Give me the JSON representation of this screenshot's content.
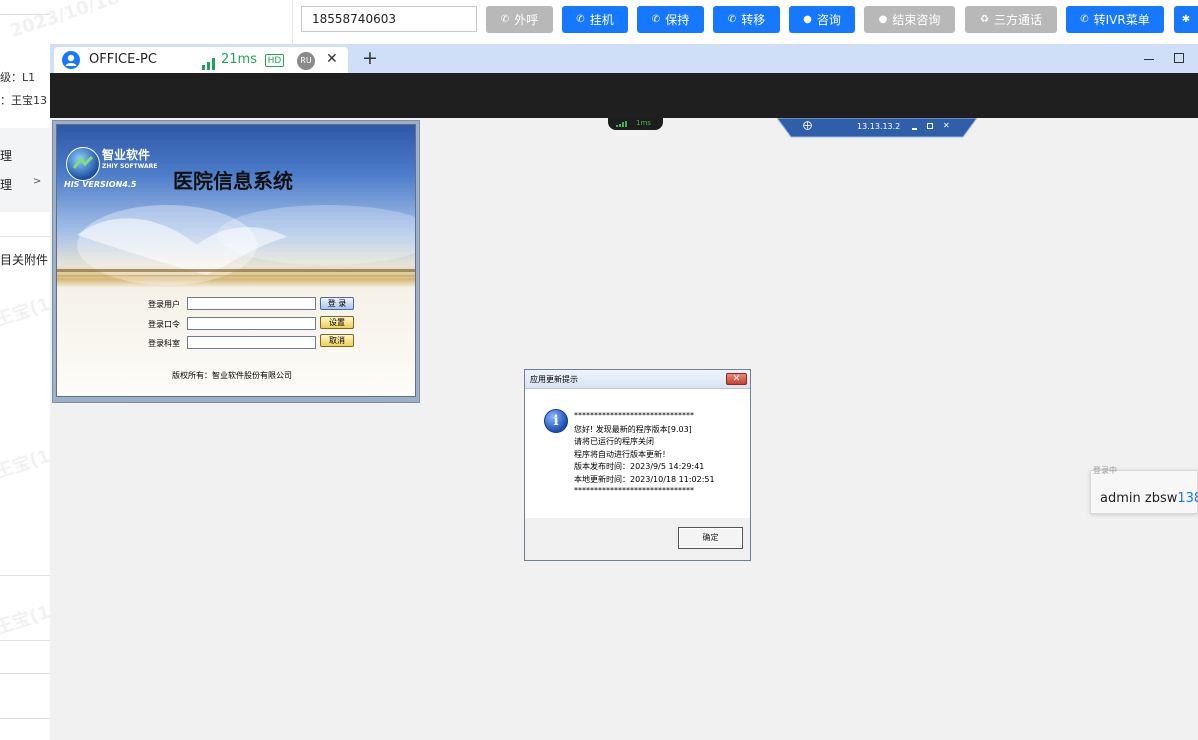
{
  "left_panel": {
    "level_label": "级：L1",
    "user_label": "：王宝13",
    "nav_item_1": "理",
    "nav_item_2": "理",
    "nav_item_2_arrow": ">",
    "attachments_label": "目关附件",
    "watermark_name": "王宝(1",
    "watermark_date": "2023/10/18"
  },
  "call_toolbar": {
    "phone_number": "18558740603",
    "buttons": [
      {
        "label": "外呼",
        "icon": "phone-icon",
        "style": "gray"
      },
      {
        "label": "挂机",
        "icon": "phone-icon",
        "style": "blue"
      },
      {
        "label": "保持",
        "icon": "phone-icon",
        "style": "blue"
      },
      {
        "label": "转移",
        "icon": "phone-icon",
        "style": "blue"
      },
      {
        "label": "咨询",
        "icon": "chat-icon",
        "style": "blue"
      },
      {
        "label": "结束咨询",
        "icon": "chat-icon",
        "style": "gray"
      },
      {
        "label": "三方通话",
        "icon": "recycle-icon",
        "style": "gray"
      },
      {
        "label": "转IVR菜单",
        "icon": "phone-icon",
        "style": "blue"
      }
    ]
  },
  "remote_window": {
    "tab_title": "OFFICE-PC",
    "latency": "21ms",
    "hd_badge": "HD",
    "ru_badge": "RU",
    "close_glyph": "✕",
    "new_tab_glyph": "+",
    "minimize_glyph": "—",
    "maximize_glyph": "☐",
    "signal_pill": "1ms",
    "connection_bar_ip": "13.13.13.2"
  },
  "his_login": {
    "brand_cn": "智业软件",
    "brand_en": "ZHIY SOFTWARE",
    "version": "HIS VERSION4.5",
    "system_title": "医院信息系统",
    "fields": [
      "登录用户",
      "登录口令",
      "登录科室"
    ],
    "buttons": [
      "登 录",
      "设置",
      "取消"
    ],
    "copyright": "版权所有：智业软件股份有限公司"
  },
  "update_dialog": {
    "title": "应用更新提示",
    "stars": "******************************",
    "lines": [
      "您好! 发现最新的程序版本[9.03]",
      "请将已运行的程序关闭",
      "程序将自动进行版本更新！",
      "版本发布时间：2023/9/5 14:29:41",
      "本地更新时间：2023/10/18 11:02:51"
    ],
    "ok_button": "确定"
  },
  "login_card": {
    "status_text": "登录中",
    "user_prefix": "admin zbsw",
    "user_suffix": "138"
  },
  "colors": {
    "toolbar_blue": "#1677ff",
    "toolbar_gray": "#b8b8b8",
    "latency_green": "#22a35a",
    "tab_bar": "#cfdff7"
  }
}
